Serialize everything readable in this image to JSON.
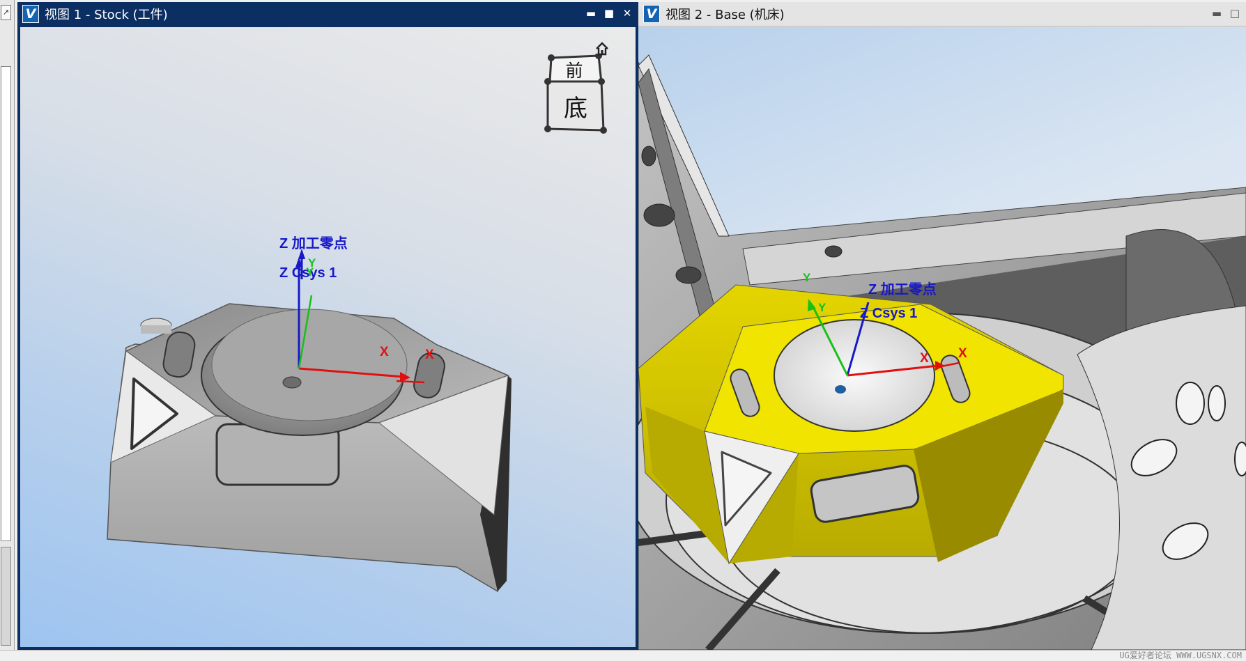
{
  "left_strip": {
    "restore_glyph": "↗"
  },
  "view1": {
    "title": "视图 1 - Stock (工件)",
    "logo": "V",
    "controls": {
      "minimize": "▬",
      "maximize": "■",
      "close": "✕"
    },
    "nav_cube": {
      "top_face": "前",
      "front_face": "底",
      "home_icon": "home-icon"
    },
    "labels": {
      "zero_point": "Z 加工零点",
      "csys": "Z Csys 1",
      "y_upper": "Y",
      "y_lower": "Y",
      "x_main": "X",
      "x_secondary": "X"
    },
    "colors": {
      "z_axis": "#1818c8",
      "x_axis": "#e01010",
      "y_axis": "#18c018",
      "part": "#9a9a9a",
      "titlebar": "#0b2e63"
    }
  },
  "view2": {
    "title": "视图 2 - Base (机床)",
    "logo": "V",
    "controls": {
      "minimize": "▬",
      "maximize": "□"
    },
    "labels": {
      "zero_point": "Z 加工零点",
      "csys": "Z Csys 1",
      "y_upper": "Y",
      "y_lower": "Y",
      "x_main": "X",
      "x_secondary": "X"
    },
    "colors": {
      "stock": "#f0e400",
      "stock_shade": "#a69b00",
      "machine": "#a8a8a8"
    }
  },
  "footer": {
    "watermark": "UG爱好者论坛 WWW.UGSNX.COM"
  }
}
